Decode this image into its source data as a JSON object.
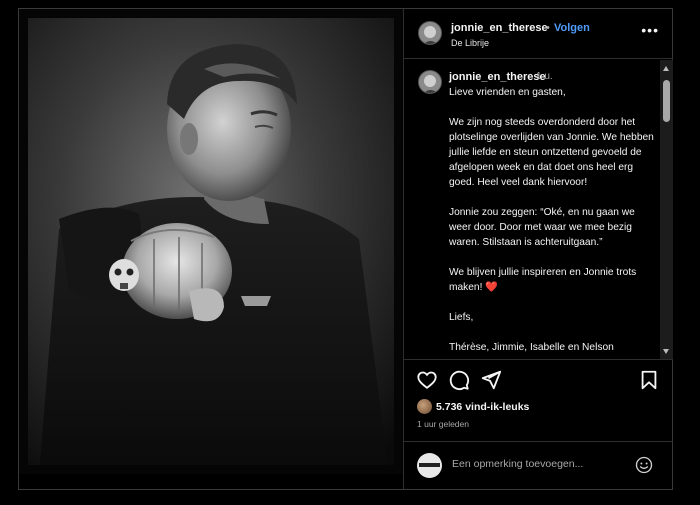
{
  "post": {
    "username": "jonnie_en_therese",
    "separator": "•",
    "follow_label": "Volgen",
    "location": "De Librije",
    "more_label": "•••"
  },
  "caption": {
    "username": "jonnie_en_therese",
    "time": "1 u.",
    "paragraphs": [
      "Lieve vrienden en gasten,",
      "We zijn nog steeds overdonderd door het plotselinge overlijden van Jonnie. We hebben jullie liefde en steun ontzettend gevoeld de afgelopen week en dat doet ons heel erg goed. Heel veel dank hiervoor!",
      "Jonnie zou zeggen: “Oké, en nu gaan we weer door. Door met waar we mee bezig waren. Stilstaan is achteruitgaan.”",
      "We blijven jullie inspireren en Jonnie trots maken!",
      "Liefs,",
      "Thérèse, Jimmie, Isabelle en Nelson"
    ],
    "heart_emoji": "❤️"
  },
  "stats": {
    "likes": "5.736 vind-ik-leuks",
    "time_ago": "1 uur geleden"
  },
  "comment": {
    "placeholder": "Een opmerking toevoegen..."
  },
  "icons": {
    "like": "heart-icon",
    "comment": "comment-icon",
    "share": "share-icon",
    "save": "bookmark-icon",
    "emoji": "emoji-icon",
    "more": "more-icon"
  },
  "colors": {
    "follow": "#4f9cf9",
    "heart": "#e0245e",
    "background": "#000000",
    "secondary_text": "#a8a8a8"
  }
}
